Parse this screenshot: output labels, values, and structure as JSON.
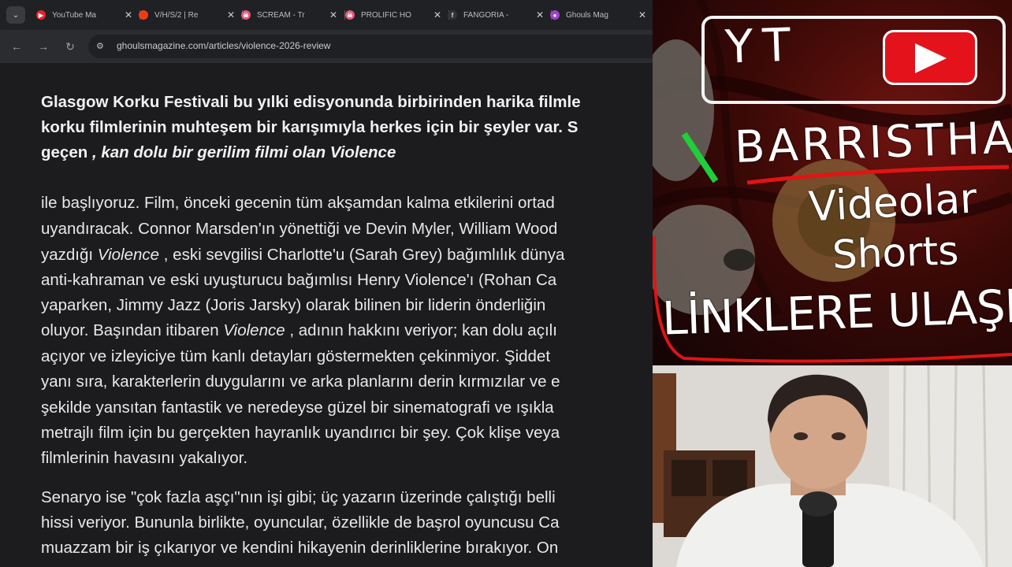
{
  "browser": {
    "tabs": [
      {
        "label": "YouTube Ma",
        "icon": "youtube-icon",
        "color": "#e8232b"
      },
      {
        "label": "V/H/S/2 | Re",
        "icon": "rotten-tomatoes-icon",
        "color": "#f23a17"
      },
      {
        "label": "SCREAM - Tr",
        "icon": "scream-icon",
        "color": "#e2577a"
      },
      {
        "label": "PROLIFIC HO",
        "icon": "prolific-icon",
        "color": "#e2577a"
      },
      {
        "label": "FANGORIA -",
        "icon": "fangoria-icon",
        "color": "#333333"
      },
      {
        "label": "Ghouls Mag",
        "icon": "ghouls-icon",
        "color": "#9b45c9"
      }
    ],
    "url": "ghoulsmagazine.com/articles/violence-2026-review"
  },
  "article": {
    "intro": [
      "Glasgow Korku Festivali bu yılki edisyonunda birbirinden harika filmle",
      "korku filmlerinin muhteşem bir karışımıyla herkes için bir şeyler var. S"
    ],
    "intro_line3_a": "geçen ",
    "intro_line3_b": ", kan dolu bir gerilim filmi olan Violence",
    "l1": " ile başlıyoruz. Film, önceki gecenin tüm akşamdan kalma etkilerini ortad",
    "l2": "uyandıracak. Connor Marsden'ın yönettiği ve Devin Myler, William Wood",
    "l3_a": "yazdığı ",
    "l3_it": "Violence",
    "l3_b": " , eski sevgilisi Charlotte'u (Sarah Grey) bağımlılık dünya",
    "l4": "anti-kahraman ve eski uyuşturucu bağımlısı Henry Violence'ı (Rohan Ca",
    "l5": "yaparken, Jimmy Jazz (Joris Jarsky) olarak bilinen bir liderin önderliğin",
    "l6_a": "oluyor. Başından itibaren ",
    "l6_it": "Violence",
    "l6_b": " , adının hakkını veriyor; kan dolu açılı",
    "l7": "açıyor ve izleyiciye tüm kanlı detayları göstermekten çekinmiyor. Şiddet",
    "l8": "yanı sıra, karakterlerin duygularını ve arka planlarını derin kırmızılar ve e",
    "l9": "şekilde yansıtan fantastik ve neredeyse güzel bir sinematografi ve ışıkla",
    "l10": "metrajlı film için bu gerçekten hayranlık uyandırıcı bir şey. Çok klişe veya",
    "l11": "filmlerinin havasını yakalıyor.",
    "p3": [
      "Senaryo ise \"çok fazla aşçı\"nın işi gibi; üç yazarın üzerinde çalıştığı belli",
      "hissi veriyor. Bununla birlikte, oyuncular, özellikle de başrol oyuncusu Ca",
      "muazzam bir iş çıkarıyor ve kendini hikayenin derinliklerine bırakıyor. On"
    ]
  },
  "thumbnail": {
    "yt_text": "YT",
    "channel": "BARRISTHAN",
    "line2": "Videolar",
    "line3": "Shorts",
    "line4": "LİNKLERE ULAŞIN"
  }
}
